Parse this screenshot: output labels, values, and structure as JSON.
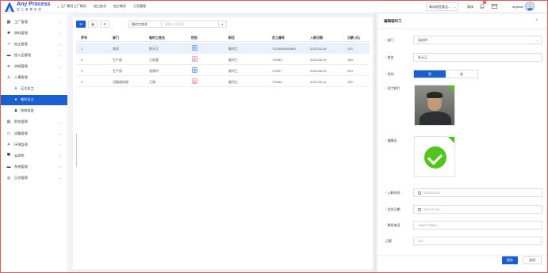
{
  "header": {
    "logo_title": "Any Process",
    "logo_subtitle": "加 工 管 理 系 统",
    "home": "工厂概况",
    "nav": [
      "工厂概况",
      "加工批次",
      "加工概况",
      "订货管理"
    ],
    "factory": "青岛振亚食品...",
    "language": "简体",
    "badge": "1",
    "user": "anyfami"
  },
  "sidebar": {
    "items": [
      {
        "icon": "factory-icon",
        "label": "工厂管理",
        "glyph": "▦",
        "chevron": "⌄"
      },
      {
        "icon": "tools-icon",
        "label": "原料管理",
        "glyph": "✖",
        "chevron": "⌄"
      },
      {
        "icon": "process-icon",
        "label": "加工管理",
        "glyph": "↗",
        "chevron": "⌄"
      },
      {
        "icon": "stock-in-icon",
        "label": "投入品管理",
        "glyph": "▬",
        "chevron": "⌄"
      },
      {
        "icon": "waste-icon",
        "label": "消耗管理",
        "glyph": "≋",
        "chevron": "⌄"
      },
      {
        "icon": "hr-icon",
        "label": "人事管理",
        "glyph": "♙",
        "chevron": "⌃"
      },
      {
        "icon": "user-icon",
        "label": "正式员工",
        "glyph": "♙",
        "chevron": "",
        "sub": true
      },
      {
        "icon": "user-icon",
        "label": "临时员工",
        "glyph": "●",
        "chevron": "",
        "sub": true,
        "active": true
      },
      {
        "icon": "users-icon",
        "label": "到岗排班",
        "glyph": "♟",
        "chevron": "",
        "sub": true
      },
      {
        "icon": "finance-icon",
        "label": "财务管理",
        "glyph": "▤",
        "chevron": "⌄"
      },
      {
        "icon": "device-icon",
        "label": "设备管理",
        "glyph": "▭",
        "chevron": "⌄"
      },
      {
        "icon": "env-icon",
        "label": "环境监测",
        "glyph": "✳",
        "chevron": "⌄"
      },
      {
        "icon": "cloud-icon",
        "label": "云商库",
        "glyph": "▀",
        "chevron": "⌄"
      },
      {
        "icon": "system-icon",
        "label": "系统管理",
        "glyph": "▬",
        "chevron": "⌄"
      },
      {
        "icon": "log-icon",
        "label": "日志管理",
        "glyph": "◎",
        "chevron": "⌄"
      }
    ]
  },
  "toolbar": {
    "search_type": "临时工姓名",
    "search_placeholder": "请输入关键词"
  },
  "table": {
    "headers": [
      "序号",
      "部门",
      "临时工姓名",
      "性别",
      "职位",
      "员工编号",
      "入职日期",
      "日薪 (元)"
    ],
    "rows": [
      {
        "no": "1",
        "dept": "测试",
        "name": "陈天正",
        "gender": "男",
        "g": "m",
        "position": "临时工",
        "id": "YG20682806661",
        "date": "2025-06-26",
        "pay": "120"
      },
      {
        "no": "2",
        "dept": "生产部",
        "name": "王彩霞",
        "gender": "女",
        "g": "f",
        "position": "临时工",
        "id": "YG055",
        "date": "2024-06-29",
        "pay": "180"
      },
      {
        "no": "3",
        "dept": "生产部",
        "name": "张建时",
        "gender": "男",
        "g": "m",
        "position": "临时工",
        "id": "YG057",
        "date": "2024-06-19",
        "pay": "220"
      },
      {
        "no": "4",
        "dept": "设备维修部",
        "name": "王瑞",
        "gender": "女",
        "g": "f",
        "position": "临时工",
        "id": "YG054",
        "date": "2024-06-11",
        "pay": "150"
      }
    ]
  },
  "drawer": {
    "title": "编辑临时工",
    "dept_label": "部门",
    "dept_value": "请选择",
    "name_label": "姓名",
    "name_value": "陈天正",
    "gender_label": "性别",
    "gender_male": "男",
    "gender_female": "女",
    "photo_label": "员工照片",
    "health_label": "健康证",
    "entry_label": "入职时间",
    "entry_value": "2025-06-26",
    "birth_label": "出生日期",
    "birth_value": "2020-07-26",
    "phone_label": "联系电话",
    "phone_value": "16667735601",
    "pay_label": "日薪",
    "pay_value": "120",
    "save": "保存",
    "cancel": "关闭"
  },
  "colors": {
    "accent": "#1a5fd0",
    "male": "#1a5fd0",
    "female": "#d0457b",
    "success": "#52c41a"
  }
}
